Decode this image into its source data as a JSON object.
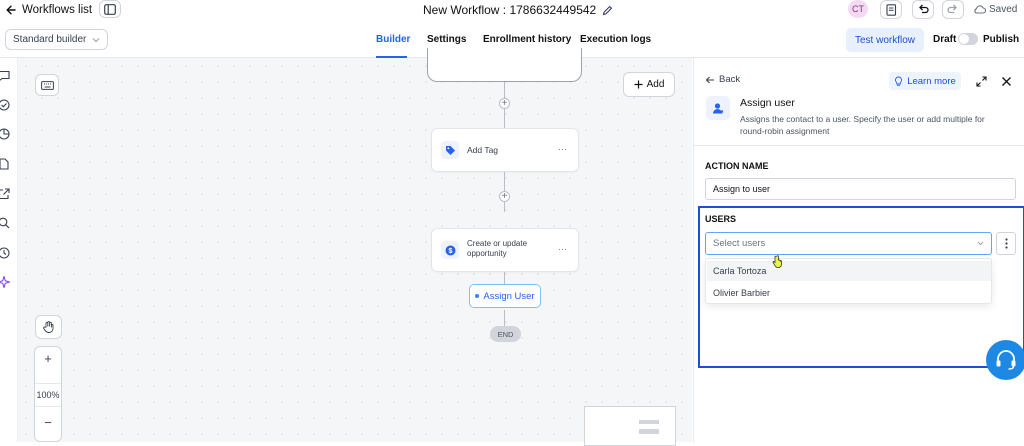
{
  "header": {
    "back_label": "Workflows list",
    "workflow_title": "New Workflow : 1786632449542",
    "avatar_initials": "CT",
    "saved_label": "Saved"
  },
  "subheader": {
    "builder_select": "Standard builder",
    "tabs": [
      "Builder",
      "Settings",
      "Enrollment history",
      "Execution logs"
    ],
    "active_tab": "Builder",
    "test_workflow_label": "Test workflow",
    "draft_label": "Draft",
    "publish_label": "Publish"
  },
  "canvas": {
    "add_label": "Add",
    "nodes": {
      "add_tag": "Add Tag",
      "opportunity": "Create or update opportunity",
      "assign_user": "Assign User",
      "end": "END"
    },
    "more_glyph": "···",
    "zoom": {
      "plus": "+",
      "level": "100%",
      "minus": "−"
    }
  },
  "panel": {
    "back_label": "Back",
    "learn_more_label": "Learn more",
    "action_title": "Assign user",
    "action_description": "Assigns the contact to a user. Specify the user or add multiple for round-robin assignment",
    "action_name_label": "ACTION NAME",
    "action_name_value": "Assign to user",
    "users_label": "USERS",
    "users_placeholder": "Select users",
    "user_options": [
      "Carla Tortoza",
      "Olivier Barbier"
    ]
  },
  "colors": {
    "accent": "#2563eb",
    "highlight_border": "#1d4ed8",
    "canvas_bg": "#f5f6f8",
    "help_button": "#1e88e5"
  }
}
